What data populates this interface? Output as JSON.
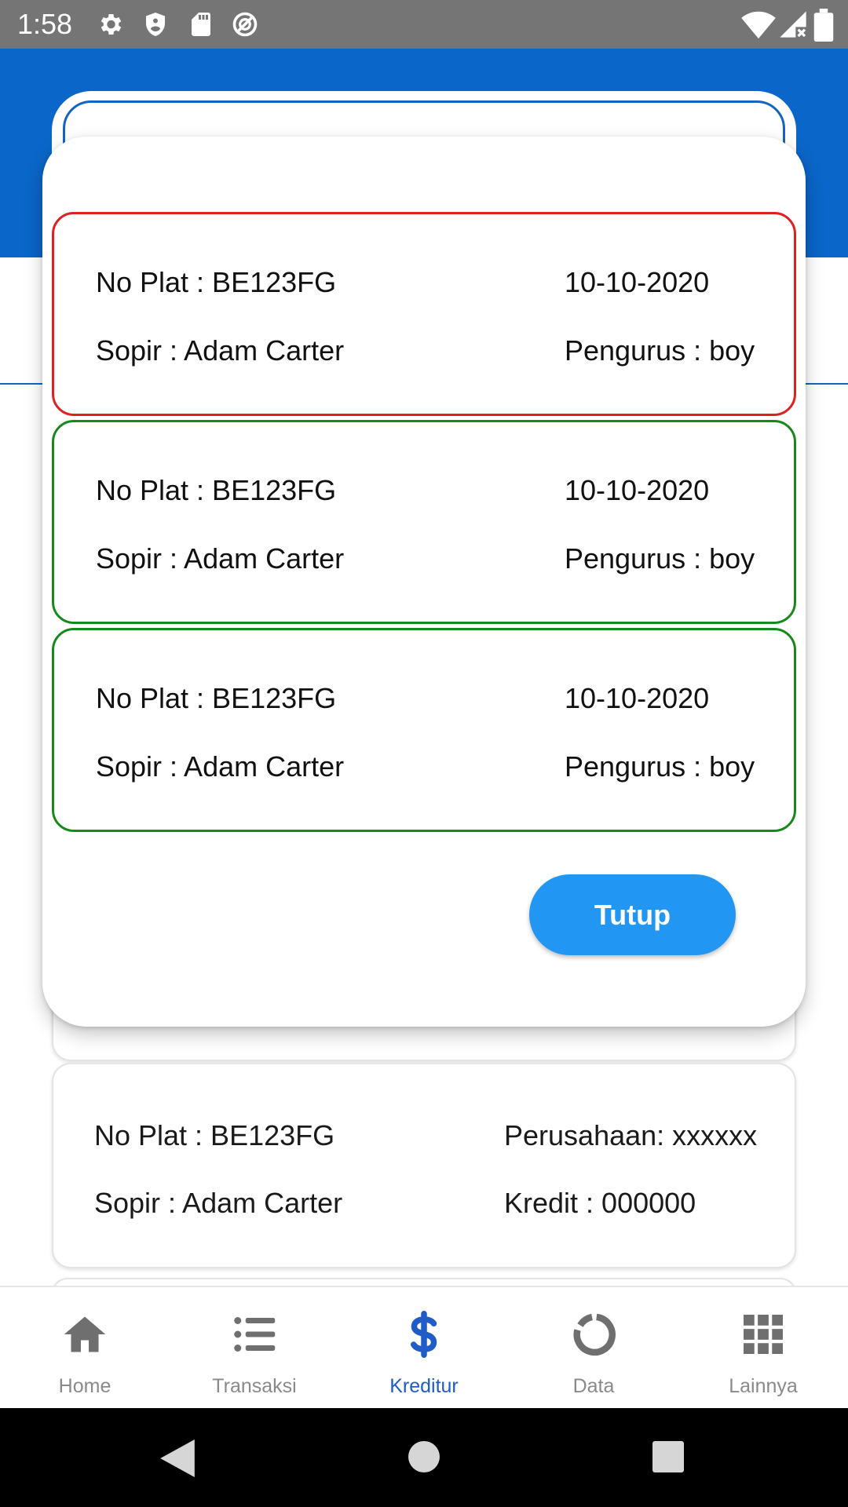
{
  "status_bar": {
    "time": "1:58"
  },
  "dialog": {
    "items": [
      {
        "plate": "No Plat : BE123FG",
        "date": "10-10-2020",
        "driver": "Sopir : Adam Carter",
        "manager": "Pengurus : boy",
        "border_color": "#e0201f"
      },
      {
        "plate": "No Plat : BE123FG",
        "date": "10-10-2020",
        "driver": "Sopir : Adam Carter",
        "manager": "Pengurus : boy",
        "border_color": "#17891a"
      },
      {
        "plate": "No Plat : BE123FG",
        "date": "10-10-2020",
        "driver": "Sopir : Adam Carter",
        "manager": "Pengurus : boy",
        "border_color": "#17891a"
      }
    ],
    "close_label": "Tutup"
  },
  "background_list": {
    "card": {
      "plate": "No Plat : BE123FG",
      "company": "Perusahaan: xxxxxx",
      "driver": "Sopir : Adam Carter",
      "credit": "Kredit : 000000"
    }
  },
  "bottom_nav": {
    "items": [
      {
        "label": "Home",
        "icon": "home-icon"
      },
      {
        "label": "Transaksi",
        "icon": "list-icon"
      },
      {
        "label": "Kreditur",
        "icon": "dollar-icon",
        "active": true
      },
      {
        "label": "Data",
        "icon": "donut-icon"
      },
      {
        "label": "Lainnya",
        "icon": "grid-icon"
      }
    ]
  },
  "colors": {
    "header": "#0a66c8",
    "accent": "#2196f3",
    "active_nav": "#1f5cc7"
  }
}
